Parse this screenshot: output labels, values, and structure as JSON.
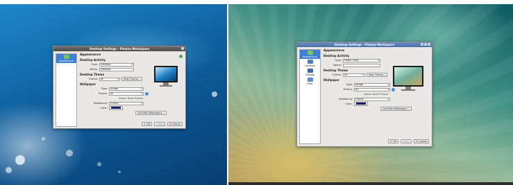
{
  "dialog_title": "Desktop Settings – Plasma Workspace",
  "sidebar": {
    "appearance": "Appearance",
    "location": "Location",
    "display": "Display",
    "filter": "Filter"
  },
  "main": {
    "heading": "Appearance",
    "desktop_activity_header": "Desktop Activity",
    "type_label": "Type:",
    "name_label": "Name:",
    "desktop_theme_header": "Desktop Theme",
    "theme_label": "Theme:",
    "theme_value": "Air",
    "new_theme_button": "New Theme...",
    "wallpaper_header": "Wallpaper",
    "wp_type_value": "Image",
    "picture_label": "Picture:",
    "picture_value": "Air",
    "author_note": "Author: Nuno Pinheiro",
    "positioning_label": "Positioning:",
    "positioning_value": "Scaled",
    "color_label": "Color:",
    "get_wallpapers_button": "Get New Wallpapers..."
  },
  "left_dialog": {
    "type_value": "Desktop",
    "name_value": "Desktop"
  },
  "right_dialog": {
    "type_value": "Folder View",
    "name_value": ""
  },
  "footer": {
    "ok": "OK",
    "apply": "Apply",
    "cancel": "Cancel"
  },
  "colors": {
    "accent": "#3d7fd4",
    "wallpaper_swatch": "#1b1b6a"
  }
}
